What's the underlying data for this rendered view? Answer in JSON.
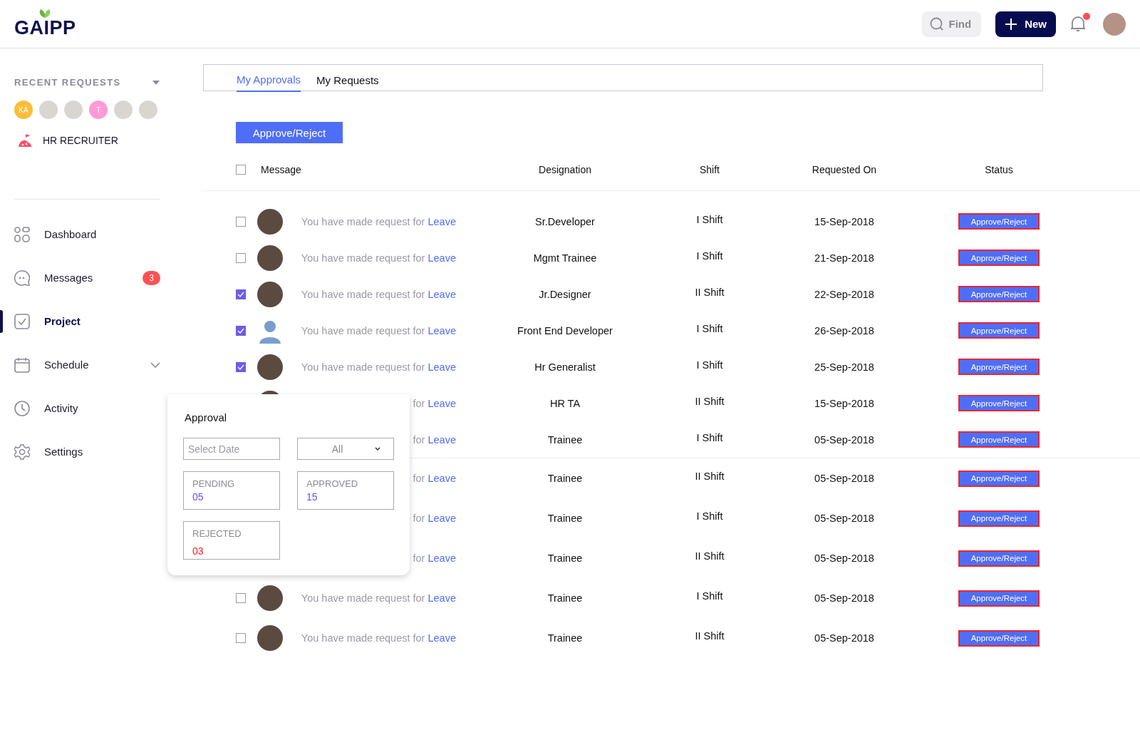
{
  "header": {
    "logo": "GAIPP",
    "find_button": "Find",
    "new_button": "New",
    "notification": {
      "unread": true
    }
  },
  "sidebar": {
    "recent_requests": {
      "title": "RECENT REQUESTS",
      "expanded": false,
      "avatars": [
        {
          "kind": "initials",
          "text": "KA",
          "color": "#fbbd3b"
        },
        {
          "kind": "photo"
        },
        {
          "kind": "photo"
        },
        {
          "kind": "initials",
          "text": "T",
          "color": "#ff9ad6"
        },
        {
          "kind": "photo"
        },
        {
          "kind": "photo"
        }
      ]
    },
    "role": "HR RECRUITER",
    "items": [
      {
        "label": "Dashboard",
        "selected": false
      },
      {
        "label": "Messages",
        "selected": false,
        "badge": "3"
      },
      {
        "label": "Project",
        "selected": true
      },
      {
        "label": "Schedule",
        "selected": false,
        "expanded": false
      },
      {
        "label": "Activity",
        "selected": false
      },
      {
        "label": "Settings",
        "selected": false
      }
    ]
  },
  "tabs": [
    {
      "label": "My Approvals",
      "selected": true
    },
    {
      "label": "My Requests",
      "selected": false
    }
  ],
  "bulk_button": "Approve/Reject",
  "table": {
    "columns": [
      "Message",
      "Designation",
      "Shift",
      "Requested On",
      "Status"
    ],
    "select_all": {
      "checked": false
    },
    "rows": [
      {
        "checked": false,
        "avatar": {
          "kind": "photo"
        },
        "message": "You have made request for",
        "link": "Leave",
        "designation": "Sr.Developer",
        "shift": "I Shift",
        "requested_on": "15-Sep-2018",
        "status": "Approve/Reject"
      },
      {
        "checked": false,
        "avatar": {
          "kind": "photo"
        },
        "message": "You have made request for",
        "link": "Leave",
        "designation": "Mgmt Trainee",
        "shift": "I Shift",
        "requested_on": "21-Sep-2018",
        "status": "Approve/Reject"
      },
      {
        "checked": true,
        "avatar": {
          "kind": "photo"
        },
        "message": "You have made request for",
        "link": "Leave",
        "designation": "Jr.Designer",
        "shift": "II Shift",
        "requested_on": "22-Sep-2018",
        "status": "Approve/Reject"
      },
      {
        "checked": true,
        "avatar": {
          "kind": "silhouette"
        },
        "message": "You have made request for",
        "link": "Leave",
        "designation": "Front End Developer",
        "shift": "I Shift",
        "requested_on": "26-Sep-2018",
        "status": "Approve/Reject"
      },
      {
        "checked": true,
        "avatar": {
          "kind": "photo"
        },
        "message": "You have made request for",
        "link": "Leave",
        "designation": "Hr Generalist",
        "shift": "I Shift",
        "requested_on": "25-Sep-2018",
        "status": "Approve/Reject"
      },
      {
        "avatar": {
          "kind": "photo"
        },
        "message": "for",
        "link": "Leave",
        "designation": "HR TA",
        "shift": "II Shift",
        "requested_on": "15-Sep-2018",
        "status": "Approve/Reject"
      },
      {
        "message": "for",
        "link": "Leave",
        "designation": "Trainee",
        "shift": "I Shift",
        "requested_on": "05-Sep-2018",
        "status": "Approve/Reject"
      },
      {
        "message": "for",
        "link": "Leave",
        "designation": "Trainee",
        "shift": "II Shift",
        "requested_on": "05-Sep-2018",
        "status": "Approve/Reject"
      },
      {
        "message": "for",
        "link": "Leave",
        "designation": "Trainee",
        "shift": "I Shift",
        "requested_on": "05-Sep-2018",
        "status": "Approve/Reject"
      },
      {
        "message": "for",
        "link": "Leave",
        "designation": "Trainee",
        "shift": "II Shift",
        "requested_on": "05-Sep-2018",
        "status": "Approve/Reject"
      },
      {
        "checked": false,
        "avatar": {
          "kind": "photo"
        },
        "message": "You have made request for",
        "link": "Leave",
        "designation": "Trainee",
        "shift": "I Shift",
        "requested_on": "05-Sep-2018",
        "status": "Approve/Reject"
      },
      {
        "checked": false,
        "avatar": {
          "kind": "photo"
        },
        "message": "You have made request for",
        "link": "Leave",
        "designation": "Trainee",
        "shift": "II Shift",
        "requested_on": "05-Sep-2018",
        "status": "Approve/Reject"
      }
    ]
  },
  "approval_popup": {
    "title": "Approval",
    "date_field": {
      "placeholder": "Select Date"
    },
    "filter_select": {
      "value": "All"
    },
    "stats": [
      {
        "label": "PENDING",
        "value": "05",
        "color": "#6c4cf0"
      },
      {
        "label": "APPROVED",
        "value": "15",
        "color": "#6c4cf0"
      },
      {
        "label": "REJECTED",
        "value": "03",
        "color": "#f01c1c"
      }
    ]
  }
}
